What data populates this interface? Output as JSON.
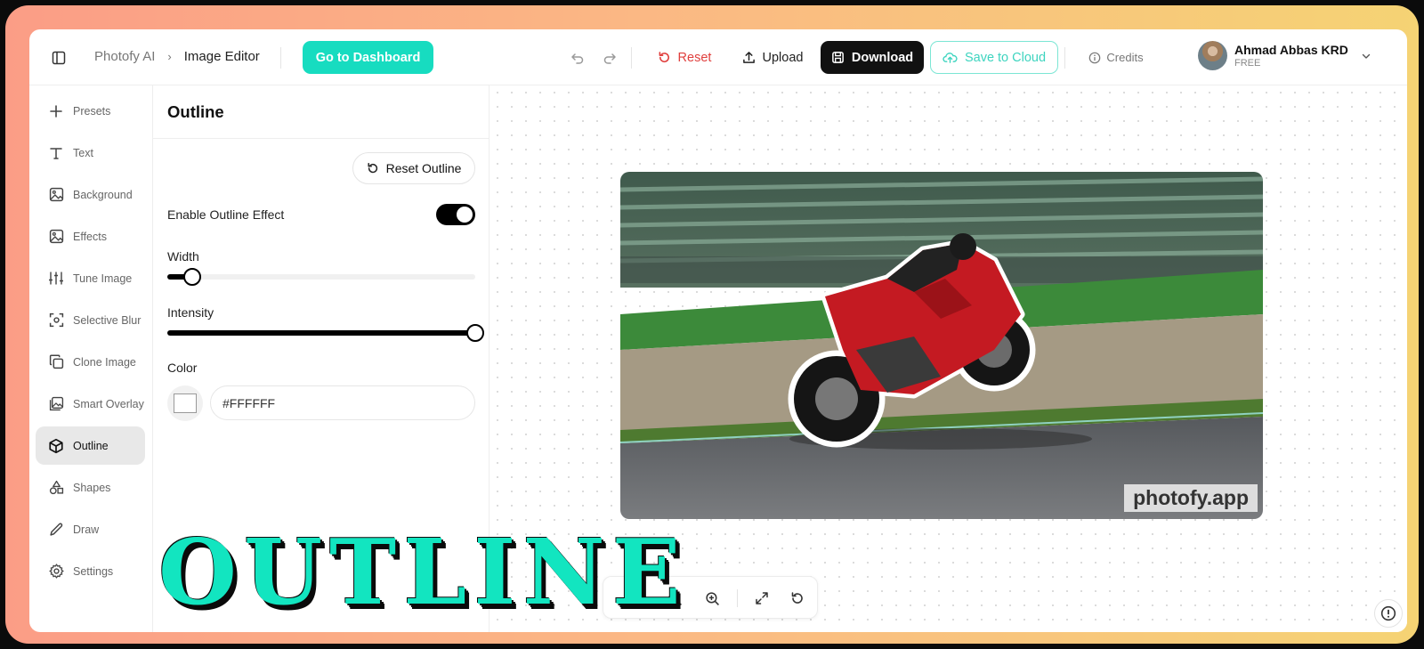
{
  "breadcrumb": {
    "root": "Photofy AI",
    "separator": "›",
    "current": "Image Editor"
  },
  "topbar": {
    "dashboard_label": "Go to Dashboard",
    "reset_label": "Reset",
    "upload_label": "Upload",
    "download_label": "Download",
    "cloud_label": "Save to Cloud",
    "credits_label": "Credits"
  },
  "user": {
    "name": "Ahmad Abbas KRD",
    "plan": "FREE"
  },
  "nav": {
    "items": [
      {
        "label": "Presets",
        "icon": "plus-icon"
      },
      {
        "label": "Text",
        "icon": "text-icon"
      },
      {
        "label": "Background",
        "icon": "image-icon"
      },
      {
        "label": "Effects",
        "icon": "image-icon"
      },
      {
        "label": "Tune Image",
        "icon": "sliders-icon"
      },
      {
        "label": "Selective Blur",
        "icon": "focus-icon"
      },
      {
        "label": "Clone Image",
        "icon": "copy-icon"
      },
      {
        "label": "Smart Overlay",
        "icon": "layers-image-icon"
      },
      {
        "label": "Outline",
        "icon": "cube-icon",
        "active": true
      },
      {
        "label": "Shapes",
        "icon": "shapes-icon"
      },
      {
        "label": "Draw",
        "icon": "pencil-icon"
      },
      {
        "label": "Settings",
        "icon": "gear-icon"
      }
    ]
  },
  "panel": {
    "title": "Outline",
    "reset_label": "Reset Outline",
    "enable_label": "Enable Outline Effect",
    "enabled": true,
    "width_label": "Width",
    "width_value": 0.08,
    "intensity_label": "Intensity",
    "intensity_value": 1.0,
    "color_label": "Color",
    "color_value": "#FFFFFF"
  },
  "canvas": {
    "watermark": "photofy.app"
  },
  "overlay": {
    "title": "OUTLINE"
  },
  "colors": {
    "accent": "#17dcc0",
    "danger": "#e0403e",
    "dark": "#111111"
  }
}
